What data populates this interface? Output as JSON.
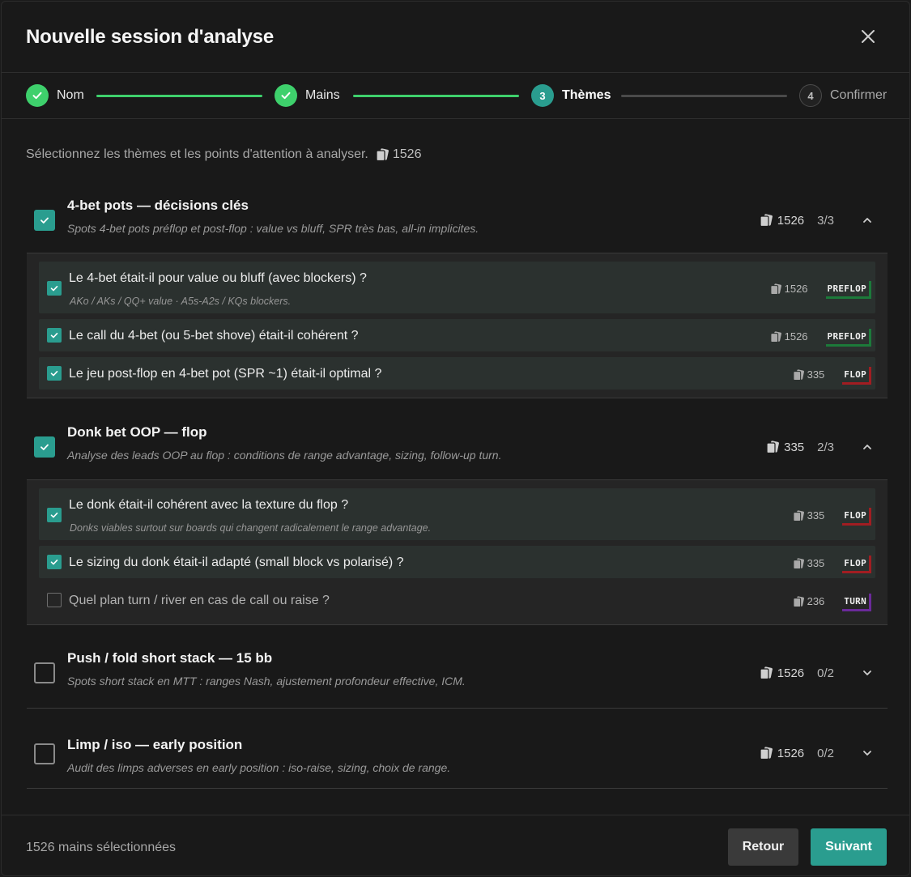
{
  "dialog": {
    "title": "Nouvelle session d'analyse"
  },
  "steps": [
    {
      "number": "1",
      "label": "Nom",
      "state": "done"
    },
    {
      "number": "2",
      "label": "Mains",
      "state": "done"
    },
    {
      "number": "3",
      "label": "Thèmes",
      "state": "active"
    },
    {
      "number": "4",
      "label": "Confirmer",
      "state": "pending"
    }
  ],
  "intro": {
    "text": "Sélectionnez les thèmes et les points d'attention à analyser.",
    "count": "1526"
  },
  "themes": [
    {
      "title": "4-bet pots — décisions clés",
      "desc": "Spots 4-bet pots préflop et post-flop : value vs bluff, SPR très bas, all-in implicites.",
      "count": "1526",
      "ratio": "3/3",
      "checked": true,
      "expanded": true,
      "items": [
        {
          "title": "Le 4-bet était-il pour value ou bluff (avec blockers) ?",
          "hint": "AKo / AKs / QQ+ value · A5s-A2s / KQs blockers.",
          "count": "1526",
          "street": "PREFLOP",
          "checked": true
        },
        {
          "title": "Le call du 4-bet (ou 5-bet shove) était-il cohérent ?",
          "count": "1526",
          "street": "PREFLOP",
          "checked": true
        },
        {
          "title": "Le jeu post-flop en 4-bet pot (SPR ~1) était-il optimal ?",
          "count": "335",
          "street": "FLOP",
          "checked": true
        }
      ]
    },
    {
      "title": "Donk bet OOP — flop",
      "desc": "Analyse des leads OOP au flop : conditions de range advantage, sizing, follow-up turn.",
      "count": "335",
      "ratio": "2/3",
      "checked": true,
      "expanded": true,
      "items": [
        {
          "title": "Le donk était-il cohérent avec la texture du flop ?",
          "hint": "Donks viables surtout sur boards qui changent radicalement le range advantage.",
          "count": "335",
          "street": "FLOP",
          "checked": true
        },
        {
          "title": "Le sizing du donk était-il adapté (small block vs polarisé) ?",
          "count": "335",
          "street": "FLOP",
          "checked": true
        },
        {
          "title": "Quel plan turn / river en cas de call ou raise ?",
          "count": "236",
          "street": "TURN",
          "checked": false
        }
      ]
    },
    {
      "title": "Push / fold short stack — 15 bb",
      "desc": "Spots short stack en MTT : ranges Nash, ajustement profondeur effective, ICM.",
      "count": "1526",
      "ratio": "0/2",
      "checked": false,
      "expanded": false
    },
    {
      "title": "Limp / iso — early position",
      "desc": "Audit des limps adverses en early position : iso-raise, sizing, choix de range.",
      "count": "1526",
      "ratio": "0/2",
      "checked": false,
      "expanded": false
    }
  ],
  "footer": {
    "summary": "1526 mains sélectionnées",
    "back_label": "Retour",
    "next_label": "Suivant"
  },
  "colors": {
    "accent": "#2a9d8f",
    "done": "#3ed06c",
    "preflop": "#1c7a3a",
    "flop": "#a11d22",
    "turn": "#6b2a9a"
  },
  "icons": {
    "card": "cards-icon",
    "close": "close-icon",
    "check": "check-icon",
    "chevron_up": "chevron-up-icon",
    "chevron_down": "chevron-down-icon"
  }
}
